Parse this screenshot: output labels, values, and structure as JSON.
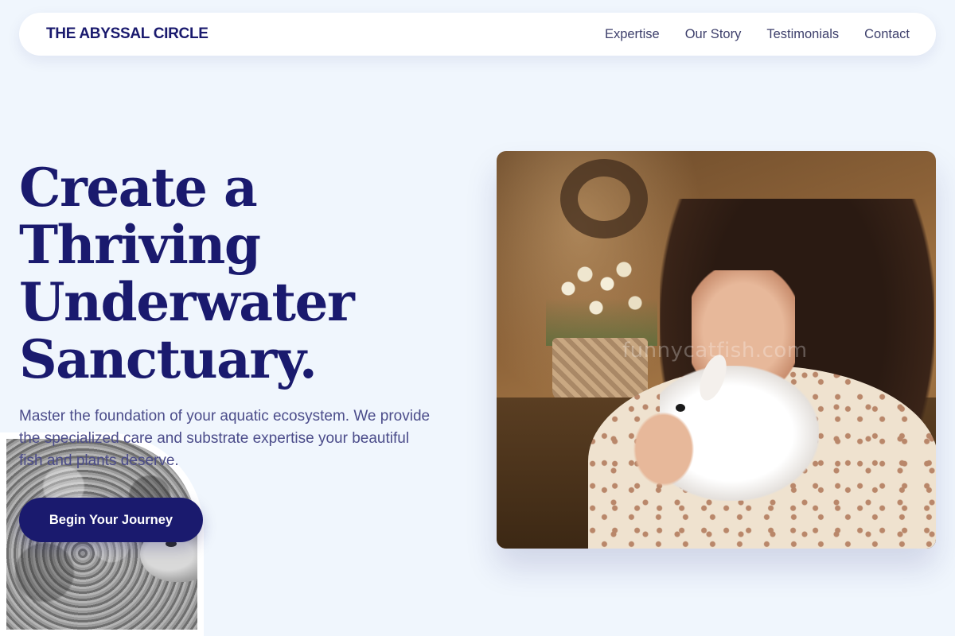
{
  "nav": {
    "brand": "THE ABYSSAL CIRCLE",
    "links": [
      "Expertise",
      "Our Story",
      "Testimonials",
      "Contact"
    ]
  },
  "hero": {
    "title_lines": [
      "Create a",
      "Thriving",
      "Underwater",
      "Sanctuary."
    ],
    "subtitle": "Master the foundation of your aquatic ecosystem. We provide the specialized care and substrate expertise your beautiful fish and plants deserve.",
    "cta_label": "Begin Your Journey"
  },
  "photo": {
    "watermark": "funnycatfish.com"
  },
  "colors": {
    "background": "#f0f6fd",
    "primary": "#1a1a6e",
    "text_muted": "#4b4c8a",
    "nav_text": "#3d3f6b"
  }
}
